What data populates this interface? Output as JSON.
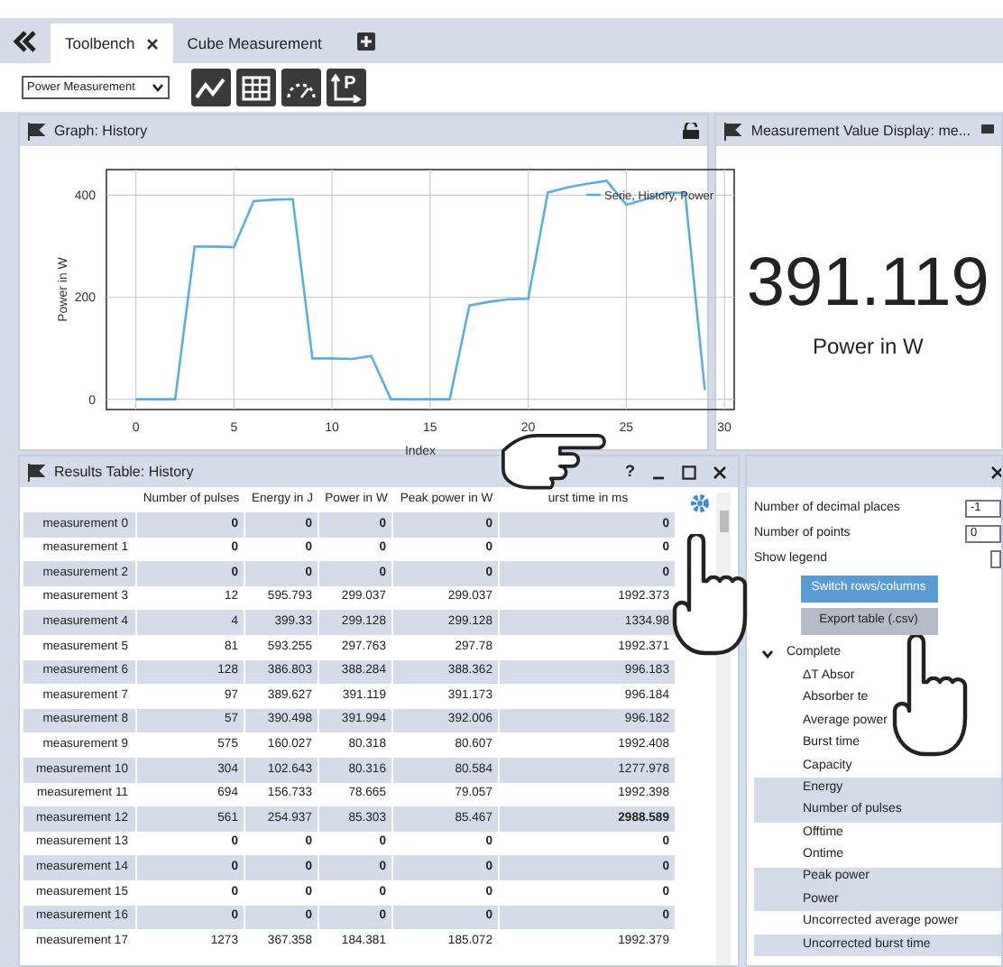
{
  "tabs": [
    {
      "label": "Toolbench",
      "selected": true,
      "closable": true
    },
    {
      "label": "Cube Measurement",
      "selected": false,
      "closable": false
    }
  ],
  "toolbar": {
    "measurement_select": "Power Measurement",
    "buttons": [
      {
        "kind": "line"
      },
      {
        "kind": "table"
      },
      {
        "kind": "gauge"
      },
      {
        "kind": "axes",
        "glyph": "P"
      }
    ]
  },
  "graph_panel": {
    "title": "Graph: History",
    "chart_data": {
      "type": "line",
      "xlabel": "Index",
      "ylabel": "Power  in W",
      "x": [
        0,
        1,
        2,
        3,
        4,
        5,
        6,
        7,
        8,
        9,
        10,
        11,
        12,
        13,
        14,
        15,
        16,
        17,
        18,
        19,
        20,
        21,
        22,
        23,
        24,
        25,
        26,
        27,
        28,
        29
      ],
      "series": [
        {
          "name": "Serie, History, Power",
          "color": "#5aaee0",
          "values": [
            0,
            0,
            0,
            299,
            299,
            298,
            388,
            391,
            392,
            80,
            80,
            79,
            85,
            0,
            0,
            0,
            0,
            184,
            191,
            196,
            197,
            405,
            415,
            422,
            428,
            381,
            392,
            405,
            404,
            18
          ]
        }
      ],
      "grid": true,
      "xlim": [
        -1.5,
        30.5
      ],
      "ylim": [
        -20,
        450
      ],
      "xticks": [
        0,
        5,
        10,
        15,
        20,
        25,
        30
      ],
      "yticks": [
        0,
        200,
        400
      ]
    }
  },
  "value_panel": {
    "title": "Measurement Value Display: me...",
    "value": "391.119",
    "unit": "Power in W"
  },
  "results_panel": {
    "title": "Results Table: History",
    "help": "?",
    "columns": [
      "Number of pulses",
      "Energy in J",
      "Power in W",
      "Peak power in W",
      "urst time in ms"
    ],
    "rows": [
      {
        "label": "measurement 0",
        "cells": [
          {
            "text": "0",
            "bold": true
          },
          {
            "text": "0",
            "bold": true
          },
          {
            "text": "0",
            "bold": true
          },
          {
            "text": "0",
            "bold": true
          },
          {
            "text": "0",
            "bold": true
          }
        ]
      },
      {
        "label": "measurement 1",
        "cells": [
          {
            "text": "0",
            "bold": true
          },
          {
            "text": "0",
            "bold": true
          },
          {
            "text": "0",
            "bold": true
          },
          {
            "text": "0",
            "bold": true
          },
          {
            "text": "0",
            "bold": true
          }
        ]
      },
      {
        "label": "measurement 2",
        "cells": [
          {
            "text": "0",
            "bold": true
          },
          {
            "text": "0",
            "bold": true
          },
          {
            "text": "0",
            "bold": true
          },
          {
            "text": "0",
            "bold": true
          },
          {
            "text": "0",
            "bold": true
          }
        ]
      },
      {
        "label": "measurement 3",
        "cells": [
          {
            "text": "12",
            "bold": false
          },
          {
            "text": "595.793",
            "bold": false
          },
          {
            "text": "299.037",
            "bold": false
          },
          {
            "text": "299.037",
            "bold": false
          },
          {
            "text": "1992.373",
            "bold": false
          }
        ]
      },
      {
        "label": "measurement 4",
        "cells": [
          {
            "text": "4",
            "bold": false
          },
          {
            "text": "399.33",
            "bold": false
          },
          {
            "text": "299.128",
            "bold": false
          },
          {
            "text": "299.128",
            "bold": false
          },
          {
            "text": "1334.98",
            "bold": false
          }
        ]
      },
      {
        "label": "measurement 5",
        "cells": [
          {
            "text": "81",
            "bold": false
          },
          {
            "text": "593.255",
            "bold": false
          },
          {
            "text": "297.763",
            "bold": false
          },
          {
            "text": "297.78",
            "bold": false
          },
          {
            "text": "1992.371",
            "bold": false
          }
        ]
      },
      {
        "label": "measurement 6",
        "cells": [
          {
            "text": "128",
            "bold": false
          },
          {
            "text": "386.803",
            "bold": false
          },
          {
            "text": "388.284",
            "bold": false
          },
          {
            "text": "388.362",
            "bold": false
          },
          {
            "text": "996.183",
            "bold": false
          }
        ]
      },
      {
        "label": "measurement 7",
        "cells": [
          {
            "text": "97",
            "bold": false
          },
          {
            "text": "389.627",
            "bold": false
          },
          {
            "text": "391.119",
            "bold": false
          },
          {
            "text": "391.173",
            "bold": false
          },
          {
            "text": "996.184",
            "bold": false
          }
        ]
      },
      {
        "label": "measurement 8",
        "cells": [
          {
            "text": "57",
            "bold": false
          },
          {
            "text": "390.498",
            "bold": false
          },
          {
            "text": "391.994",
            "bold": false
          },
          {
            "text": "392.006",
            "bold": false
          },
          {
            "text": "996.182",
            "bold": false
          }
        ]
      },
      {
        "label": "measurement 9",
        "cells": [
          {
            "text": "575",
            "bold": false
          },
          {
            "text": "160.027",
            "bold": false
          },
          {
            "text": "80.318",
            "bold": false
          },
          {
            "text": "80.607",
            "bold": false
          },
          {
            "text": "1992.408",
            "bold": false
          }
        ]
      },
      {
        "label": "measurement 10",
        "cells": [
          {
            "text": "304",
            "bold": false
          },
          {
            "text": "102.643",
            "bold": false
          },
          {
            "text": "80.316",
            "bold": false
          },
          {
            "text": "80.584",
            "bold": false
          },
          {
            "text": "1277.978",
            "bold": false
          }
        ]
      },
      {
        "label": "measurement 11",
        "cells": [
          {
            "text": "694",
            "bold": false
          },
          {
            "text": "156.733",
            "bold": false
          },
          {
            "text": "78.665",
            "bold": false
          },
          {
            "text": "79.057",
            "bold": false
          },
          {
            "text": "1992.398",
            "bold": false
          }
        ]
      },
      {
        "label": "measurement 12",
        "cells": [
          {
            "text": "561",
            "bold": false
          },
          {
            "text": "254.937",
            "bold": false
          },
          {
            "text": "85.303",
            "bold": false
          },
          {
            "text": "85.467",
            "bold": false
          },
          {
            "text": "2988.589",
            "bold": true
          }
        ]
      },
      {
        "label": "measurement 13",
        "cells": [
          {
            "text": "0",
            "bold": true
          },
          {
            "text": "0",
            "bold": true
          },
          {
            "text": "0",
            "bold": true
          },
          {
            "text": "0",
            "bold": true
          },
          {
            "text": "0",
            "bold": true
          }
        ]
      },
      {
        "label": "measurement 14",
        "cells": [
          {
            "text": "0",
            "bold": true
          },
          {
            "text": "0",
            "bold": true
          },
          {
            "text": "0",
            "bold": true
          },
          {
            "text": "0",
            "bold": true
          },
          {
            "text": "0",
            "bold": true
          }
        ]
      },
      {
        "label": "measurement 15",
        "cells": [
          {
            "text": "0",
            "bold": true
          },
          {
            "text": "0",
            "bold": true
          },
          {
            "text": "0",
            "bold": true
          },
          {
            "text": "0",
            "bold": true
          },
          {
            "text": "0",
            "bold": true
          }
        ]
      },
      {
        "label": "measurement 16",
        "cells": [
          {
            "text": "0",
            "bold": true
          },
          {
            "text": "0",
            "bold": true
          },
          {
            "text": "0",
            "bold": true
          },
          {
            "text": "0",
            "bold": true
          },
          {
            "text": "0",
            "bold": true
          }
        ]
      },
      {
        "label": "measurement 17",
        "cells": [
          {
            "text": "1273",
            "bold": false
          },
          {
            "text": "367.358",
            "bold": false
          },
          {
            "text": "184.381",
            "bold": false
          },
          {
            "text": "185.072",
            "bold": false
          },
          {
            "text": "1992.379",
            "bold": false
          }
        ]
      }
    ]
  },
  "settings_panel": {
    "fields": [
      {
        "label": "Number of decimal places",
        "value": "-1"
      },
      {
        "label": "Number of points",
        "value": "0"
      }
    ],
    "show_legend": {
      "label": "Show legend"
    },
    "buttons": [
      {
        "label": "Switch rows/columns",
        "selected": true
      },
      {
        "label": "Export table (.csv)",
        "selected": false
      }
    ],
    "tree": [
      {
        "label": "Complete",
        "expanded": true,
        "children": [
          {
            "label": "ΔT Absor",
            "selected": false
          },
          {
            "label": "Absorber te",
            "selected": false
          },
          {
            "label": "Average power",
            "selected": false
          },
          {
            "label": "Burst time",
            "selected": false
          },
          {
            "label": "Capacity",
            "selected": false
          },
          {
            "label": "Energy",
            "selected": true
          },
          {
            "label": "Number of pulses",
            "selected": true
          },
          {
            "label": "Offtime",
            "selected": false
          },
          {
            "label": "Ontime",
            "selected": false
          },
          {
            "label": "Peak power",
            "selected": true
          },
          {
            "label": "Power",
            "selected": true
          },
          {
            "label": "Uncorrected average power",
            "selected": false
          },
          {
            "label": "Uncorrected burst time",
            "selected": true
          }
        ]
      }
    ]
  }
}
